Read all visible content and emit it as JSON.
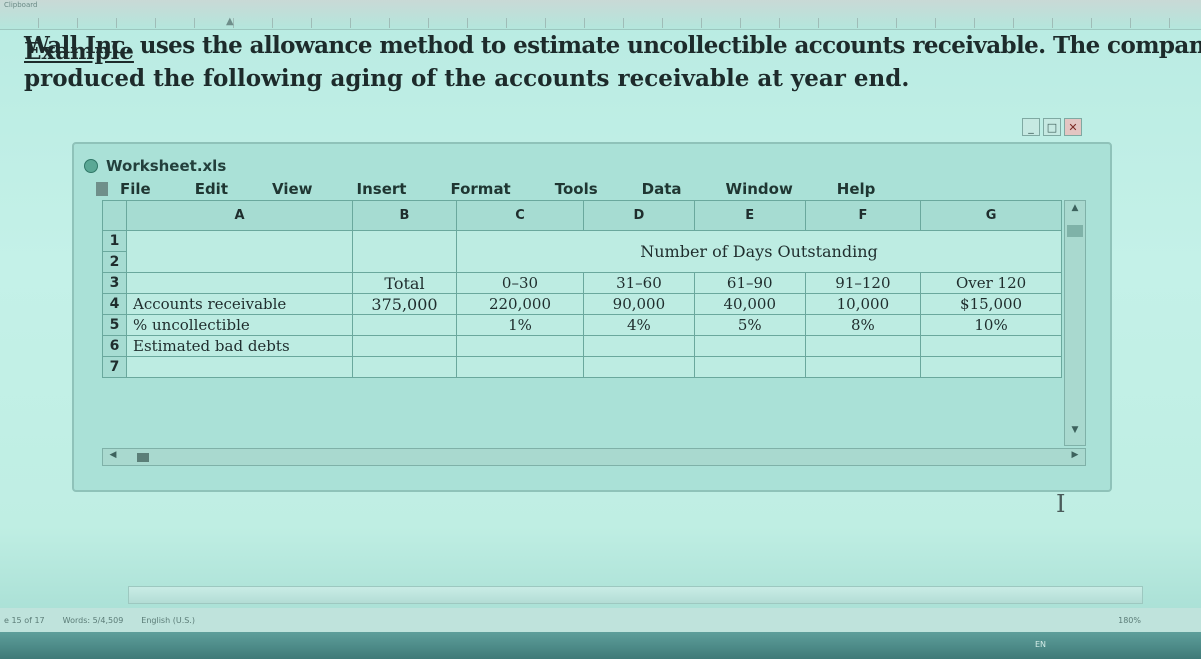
{
  "ruler": {
    "clip_label": "Clipboard"
  },
  "slide": {
    "heading": "Example",
    "paragraph_line1": "Wall Inc. uses the allowance method to estimate uncollectible accounts receivable. The company",
    "paragraph_line2": "produced the following aging of the accounts receivable at year end.",
    "first_words": "uses the allowance method to estimate uncollectible accounts receivable. The company"
  },
  "window": {
    "title": "Worksheet.xls",
    "controls": [
      "_",
      "□",
      "✕"
    ],
    "menu": [
      "File",
      "Edit",
      "View",
      "Insert",
      "Format",
      "Tools",
      "Data",
      "Window",
      "Help"
    ]
  },
  "sheet": {
    "columns": [
      "A",
      "B",
      "C",
      "D",
      "E",
      "F",
      "G"
    ],
    "rows": [
      "1",
      "2",
      "3",
      "4",
      "5",
      "6",
      "7"
    ],
    "group_header": "Number of Days Outstanding",
    "total_label": "Total",
    "buckets": [
      "0–30",
      "31–60",
      "61–90",
      "91–120",
      "Over 120"
    ],
    "row4": {
      "label": "Accounts receivable",
      "total": "375,000",
      "values": [
        "220,000",
        "90,000",
        "40,000",
        "10,000",
        "$15,000"
      ]
    },
    "row5": {
      "label": "% uncollectible",
      "values": [
        "1%",
        "4%",
        "5%",
        "8%",
        "10%"
      ]
    },
    "row6": {
      "label": "Estimated bad debts"
    }
  },
  "statusbar": {
    "page": "e 15 of 17",
    "words": "Words: 5/4,509",
    "language": "English (U.S.)",
    "zoom": "180%"
  },
  "taskbar": {
    "lang": "EN"
  }
}
